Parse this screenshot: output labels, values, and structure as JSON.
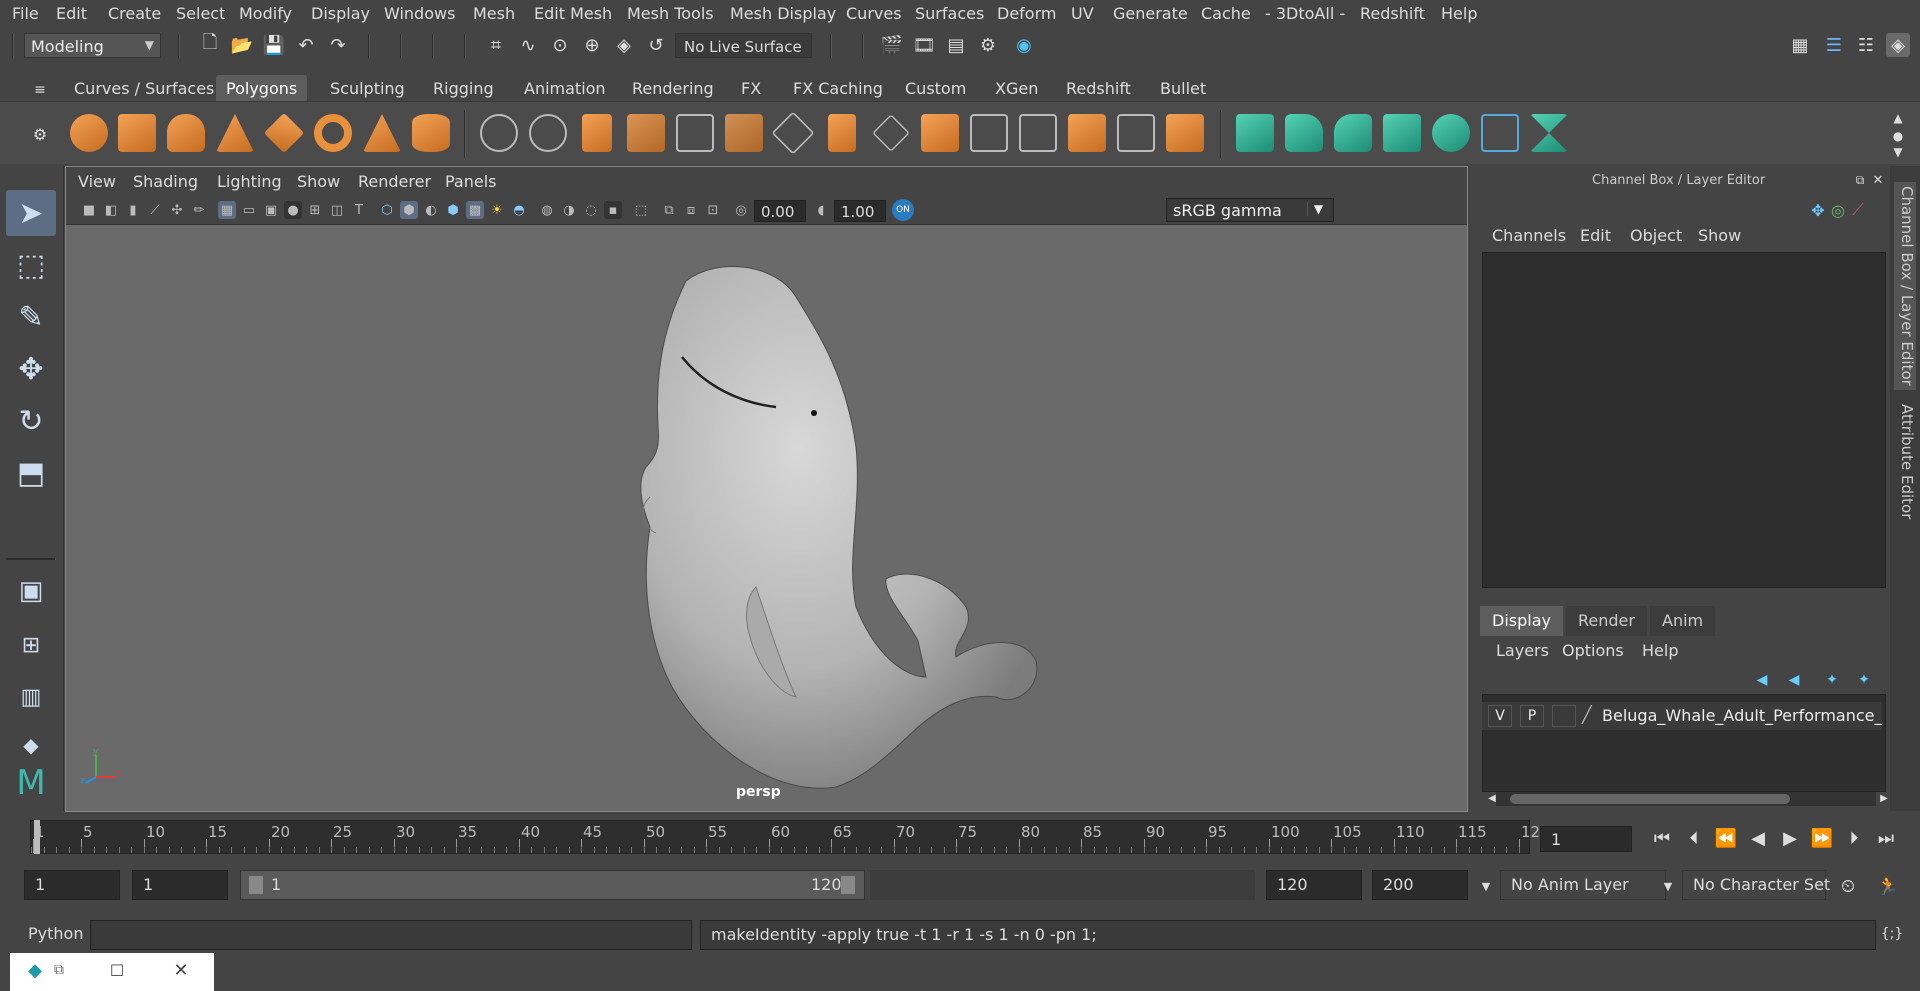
{
  "menubar": {
    "items": [
      "File",
      "Edit",
      "Create",
      "Select",
      "Modify",
      "Display",
      "Windows",
      "Mesh",
      "Edit Mesh",
      "Mesh Tools",
      "Mesh Display",
      "Curves",
      "Surfaces",
      "Deform",
      "UV",
      "Generate",
      "Cache",
      "- 3DtoAll -",
      "Redshift",
      "Help"
    ]
  },
  "statusline": {
    "mode": "Modeling",
    "live_surface": "No Live Surface"
  },
  "shelf": {
    "tabs": [
      "Curves / Surfaces",
      "Polygons",
      "Sculpting",
      "Rigging",
      "Animation",
      "Rendering",
      "FX",
      "FX Caching",
      "Custom",
      "XGen",
      "Redshift",
      "Bullet"
    ],
    "active_tab": "Polygons"
  },
  "viewport": {
    "menu": [
      "View",
      "Shading",
      "Lighting",
      "Show",
      "Renderer",
      "Panels"
    ],
    "exposure": "0.00",
    "gamma_value": "1.00",
    "color_space": "sRGB gamma",
    "camera_label": "persp",
    "axis_x": "x",
    "axis_y": "y",
    "axis_z": "z"
  },
  "channel_box": {
    "title": "Channel Box / Layer Editor",
    "menu": [
      "Channels",
      "Edit",
      "Object",
      "Show"
    ]
  },
  "layer_editor": {
    "tabs": [
      "Display",
      "Render",
      "Anim"
    ],
    "active_tab": "Display",
    "menu": [
      "Layers",
      "Options",
      "Help"
    ],
    "layer": {
      "v": "V",
      "p": "P",
      "name": "Beluga_Whale_Adult_Performance_Po"
    }
  },
  "side_tabs": [
    "Channel Box / Layer Editor",
    "Attribute Editor"
  ],
  "timeline": {
    "labels": [
      "1",
      "5",
      "10",
      "15",
      "20",
      "25",
      "30",
      "35",
      "40",
      "45",
      "50",
      "55",
      "60",
      "65",
      "70",
      "75",
      "80",
      "85",
      "90",
      "95",
      "100",
      "105",
      "110",
      "115",
      "12"
    ],
    "current_frame": "1"
  },
  "range": {
    "start": "1",
    "playback_start": "1",
    "slider_start": "1",
    "slider_end": "120",
    "playback_end": "120",
    "end": "200",
    "anim_layer": "No Anim Layer",
    "character_set": "No Character Set"
  },
  "cmdline": {
    "language": "Python",
    "output": "makeIdentity -apply true -t 1 -r 1 -s 1 -n 0 -pn 1;"
  },
  "colors": {
    "accent_orange": "#e8903c",
    "accent_teal": "#3fb89a",
    "viewport_bg": "#6a6a6a"
  }
}
